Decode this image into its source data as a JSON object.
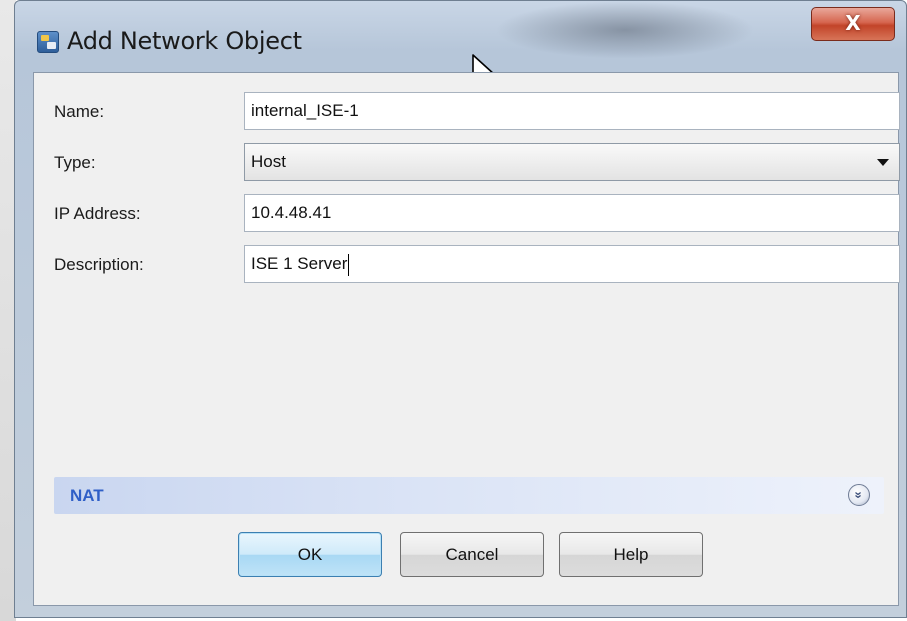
{
  "window": {
    "title": "Add Network Object",
    "close_label": "X"
  },
  "form": {
    "name_label": "Name:",
    "name_value": "internal_ISE-1",
    "type_label": "Type:",
    "type_value": "Host",
    "ip_label": "IP Address:",
    "ip_value": "10.4.48.41",
    "description_label": "Description:",
    "description_value": "ISE 1 Server"
  },
  "nat": {
    "label": "NAT",
    "expand_icon": "double-chevron-down-icon",
    "expand_glyph": "»"
  },
  "buttons": {
    "ok": "OK",
    "cancel": "Cancel",
    "help": "Help"
  }
}
